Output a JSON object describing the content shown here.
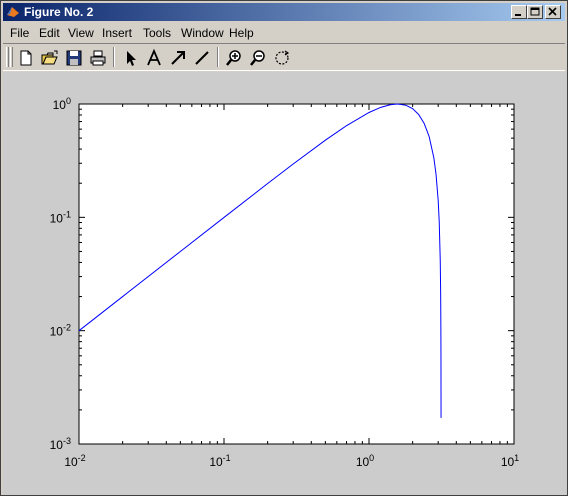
{
  "window": {
    "title": "Figure No. 2"
  },
  "menubar": {
    "items": [
      "File",
      "Edit",
      "View",
      "Insert",
      "Tools",
      "Window",
      "Help"
    ]
  },
  "toolbar": {
    "buttons": [
      "new-file-icon",
      "open-folder-icon",
      "save-icon",
      "print-icon",
      "select-arrow-icon",
      "insert-text-icon",
      "insert-arrow-icon",
      "insert-line-icon",
      "zoom-in-icon",
      "zoom-out-icon",
      "rotate-3d-icon"
    ]
  },
  "colors": {
    "title_start": "#0a246a",
    "title_end": "#a6caf0",
    "figure_bg": "#cccccc",
    "axes_bg": "#ffffff",
    "line": "#0000ff"
  },
  "chart_data": {
    "type": "line",
    "xscale": "log",
    "yscale": "log",
    "xlim": [
      0.01,
      10
    ],
    "ylim": [
      0.001,
      1
    ],
    "x_tick_labels": [
      {
        "base": "10",
        "exp": "-2"
      },
      {
        "base": "10",
        "exp": "-1"
      },
      {
        "base": "10",
        "exp": "0"
      },
      {
        "base": "10",
        "exp": "1"
      }
    ],
    "y_tick_labels": [
      {
        "base": "10",
        "exp": "-3"
      },
      {
        "base": "10",
        "exp": "-2"
      },
      {
        "base": "10",
        "exp": "-1"
      },
      {
        "base": "10",
        "exp": "0"
      }
    ],
    "grid": false,
    "series": [
      {
        "x": [
          0.01,
          0.02,
          0.05,
          0.1,
          0.2,
          0.3,
          0.5,
          0.7,
          1.0,
          1.2,
          1.4,
          1.5708,
          1.8,
          2.0,
          2.2,
          2.4,
          2.6,
          2.8,
          2.9,
          3.0,
          3.05,
          3.1,
          3.12,
          3.13,
          3.135,
          3.1399
        ],
        "y": [
          0.01,
          0.02,
          0.04998,
          0.09983,
          0.1987,
          0.2955,
          0.4794,
          0.6442,
          0.8415,
          0.932,
          0.9854,
          1.0,
          0.9738,
          0.9093,
          0.8085,
          0.6755,
          0.5155,
          0.335,
          0.2392,
          0.1411,
          0.09146,
          0.04158,
          0.02159,
          0.01159,
          0.006593,
          0.0017
        ]
      }
    ]
  }
}
